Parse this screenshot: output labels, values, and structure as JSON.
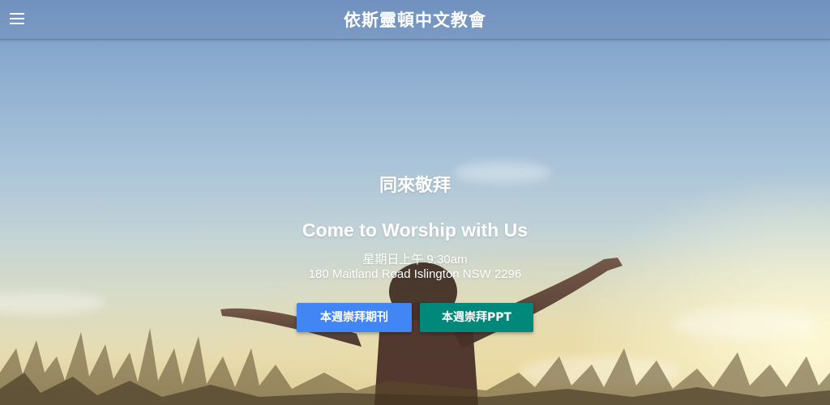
{
  "header": {
    "menu_icon": "hamburger-menu-icon",
    "title": "依斯靈頓中文教會"
  },
  "hero": {
    "heading_cn": "同來敬拜",
    "heading_en": "Come to Worship with Us",
    "service_time": "星期日上午 9:30am",
    "address": "180 Maitland Road Islington NSW 2296",
    "buttons": [
      {
        "label": "本週崇拜期刊",
        "color": "#4285f4"
      },
      {
        "label": "本週崇拜PPT",
        "color": "#00897b"
      }
    ]
  }
}
